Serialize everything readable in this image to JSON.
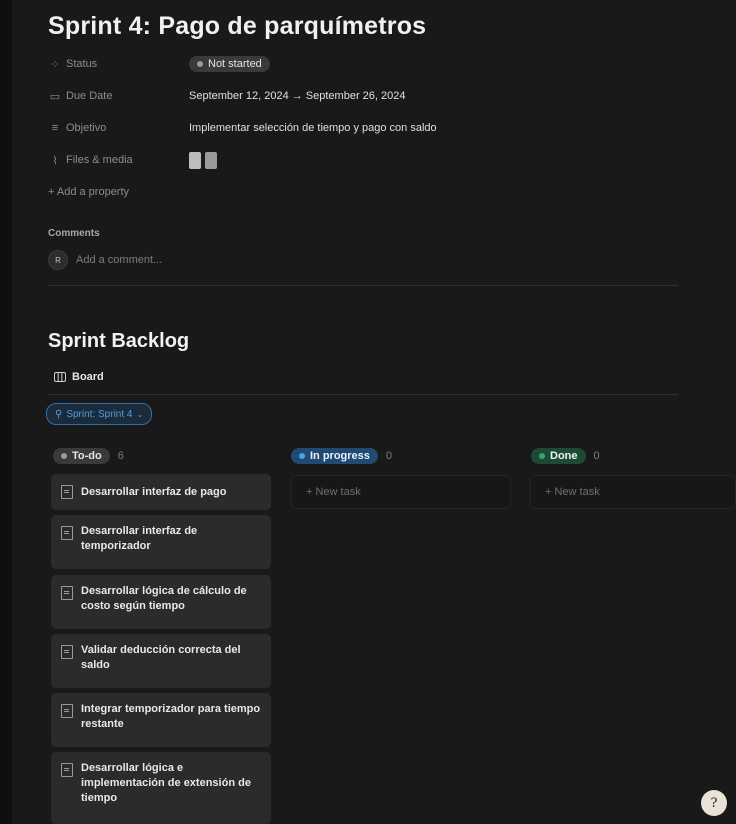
{
  "page": {
    "title": "Sprint 4: Pago de parquímetros"
  },
  "properties": [
    {
      "icon": "status-icon",
      "glyph": "⁘",
      "label": "Status",
      "value": "Not started"
    },
    {
      "icon": "calendar-icon",
      "glyph": "▭",
      "label": "Due Date",
      "value": "September 12, 2024 → September 26, 2024"
    },
    {
      "icon": "text-lines-icon",
      "glyph": "≡",
      "label": "Objetivo",
      "value": "Implementar selección de tiempo y pago con saldo"
    },
    {
      "icon": "paperclip-icon",
      "glyph": "⌇",
      "label": "Files & media",
      "value": ""
    }
  ],
  "add_property": "+ Add a property",
  "comments": {
    "heading": "Comments",
    "avatar_letter": "R",
    "placeholder": "Add a comment..."
  },
  "backlog": {
    "heading": "Sprint Backlog",
    "view_tab": "Board",
    "filter": "Sprint: Sprint 4"
  },
  "columns": [
    {
      "label": "To-do",
      "count": "6",
      "color": "#3a3a3a"
    },
    {
      "label": "In progress",
      "count": "0",
      "color": "#214a73",
      "new_task": "+ New task"
    },
    {
      "label": "Done",
      "count": "0",
      "color": "#1e4a35",
      "new_task": "+ New task"
    }
  ],
  "cards": [
    "Desarrollar interfaz de pago",
    "Desarrollar interfaz de temporizador",
    "Desarrollar lógica de cálculo de costo según tiempo",
    "Validar deducción correcta del saldo",
    "Integrar temporizador para tiempo restante",
    "Desarrollar lógica e implementación de extensión de tiempo"
  ],
  "help_button": "?"
}
